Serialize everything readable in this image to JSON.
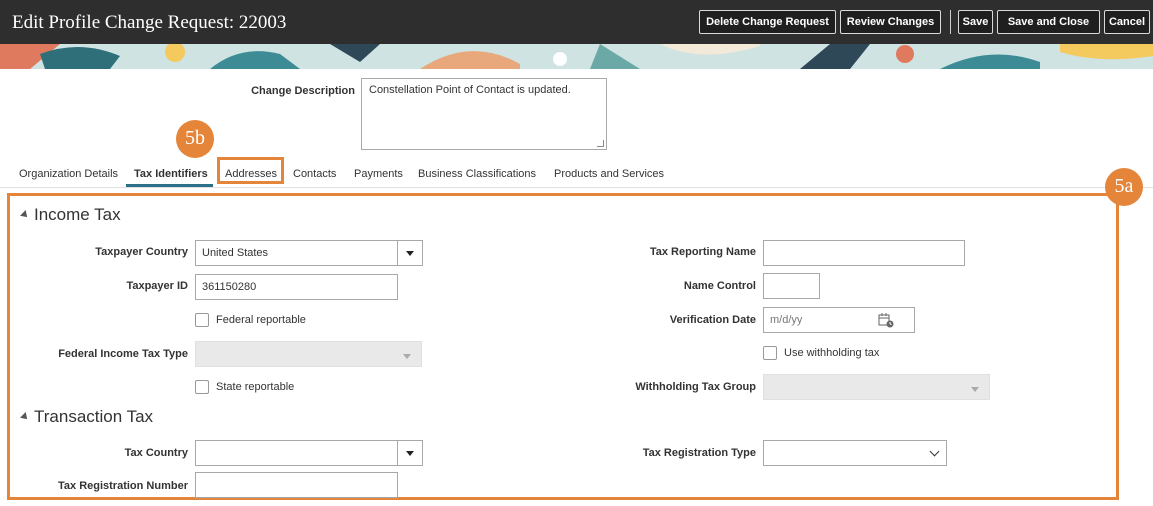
{
  "header": {
    "title": "Edit Profile Change Request: 22003",
    "buttons": {
      "delete": "Delete Change Request",
      "review": "Review Changes",
      "save": "Save",
      "save_close": "Save and Close",
      "cancel": "Cancel"
    }
  },
  "change_description": {
    "label": "Change Description",
    "value": "Constellation Point of Contact is updated."
  },
  "tabs": [
    {
      "label": "Organization Details"
    },
    {
      "label": "Tax Identifiers",
      "active": true
    },
    {
      "label": "Addresses"
    },
    {
      "label": "Contacts"
    },
    {
      "label": "Payments"
    },
    {
      "label": "Business Classifications"
    },
    {
      "label": "Products and Services"
    }
  ],
  "callouts": {
    "a": "5a",
    "b": "5b"
  },
  "income_tax": {
    "title": "Income Tax",
    "taxpayer_country": {
      "label": "Taxpayer Country",
      "value": "United States"
    },
    "taxpayer_id": {
      "label": "Taxpayer ID",
      "value": "361150280"
    },
    "federal_reportable": {
      "label": "Federal reportable",
      "checked": false
    },
    "federal_income_tax_type": {
      "label": "Federal Income Tax Type",
      "value": ""
    },
    "state_reportable": {
      "label": "State reportable",
      "checked": false
    },
    "tax_reporting_name": {
      "label": "Tax Reporting Name",
      "value": ""
    },
    "name_control": {
      "label": "Name Control",
      "value": ""
    },
    "verification_date": {
      "label": "Verification Date",
      "placeholder": "m/d/yy"
    },
    "use_withholding_tax": {
      "label": "Use withholding tax",
      "checked": false
    },
    "withholding_tax_group": {
      "label": "Withholding Tax Group",
      "value": ""
    }
  },
  "transaction_tax": {
    "title": "Transaction Tax",
    "tax_country": {
      "label": "Tax Country",
      "value": ""
    },
    "tax_registration_number": {
      "label": "Tax Registration Number",
      "value": ""
    },
    "tax_registration_type": {
      "label": "Tax Registration Type",
      "value": ""
    }
  },
  "colors": {
    "accent": "#e4853a",
    "tab_underline": "#2d6f86",
    "header_bg": "#2e2e2e"
  }
}
